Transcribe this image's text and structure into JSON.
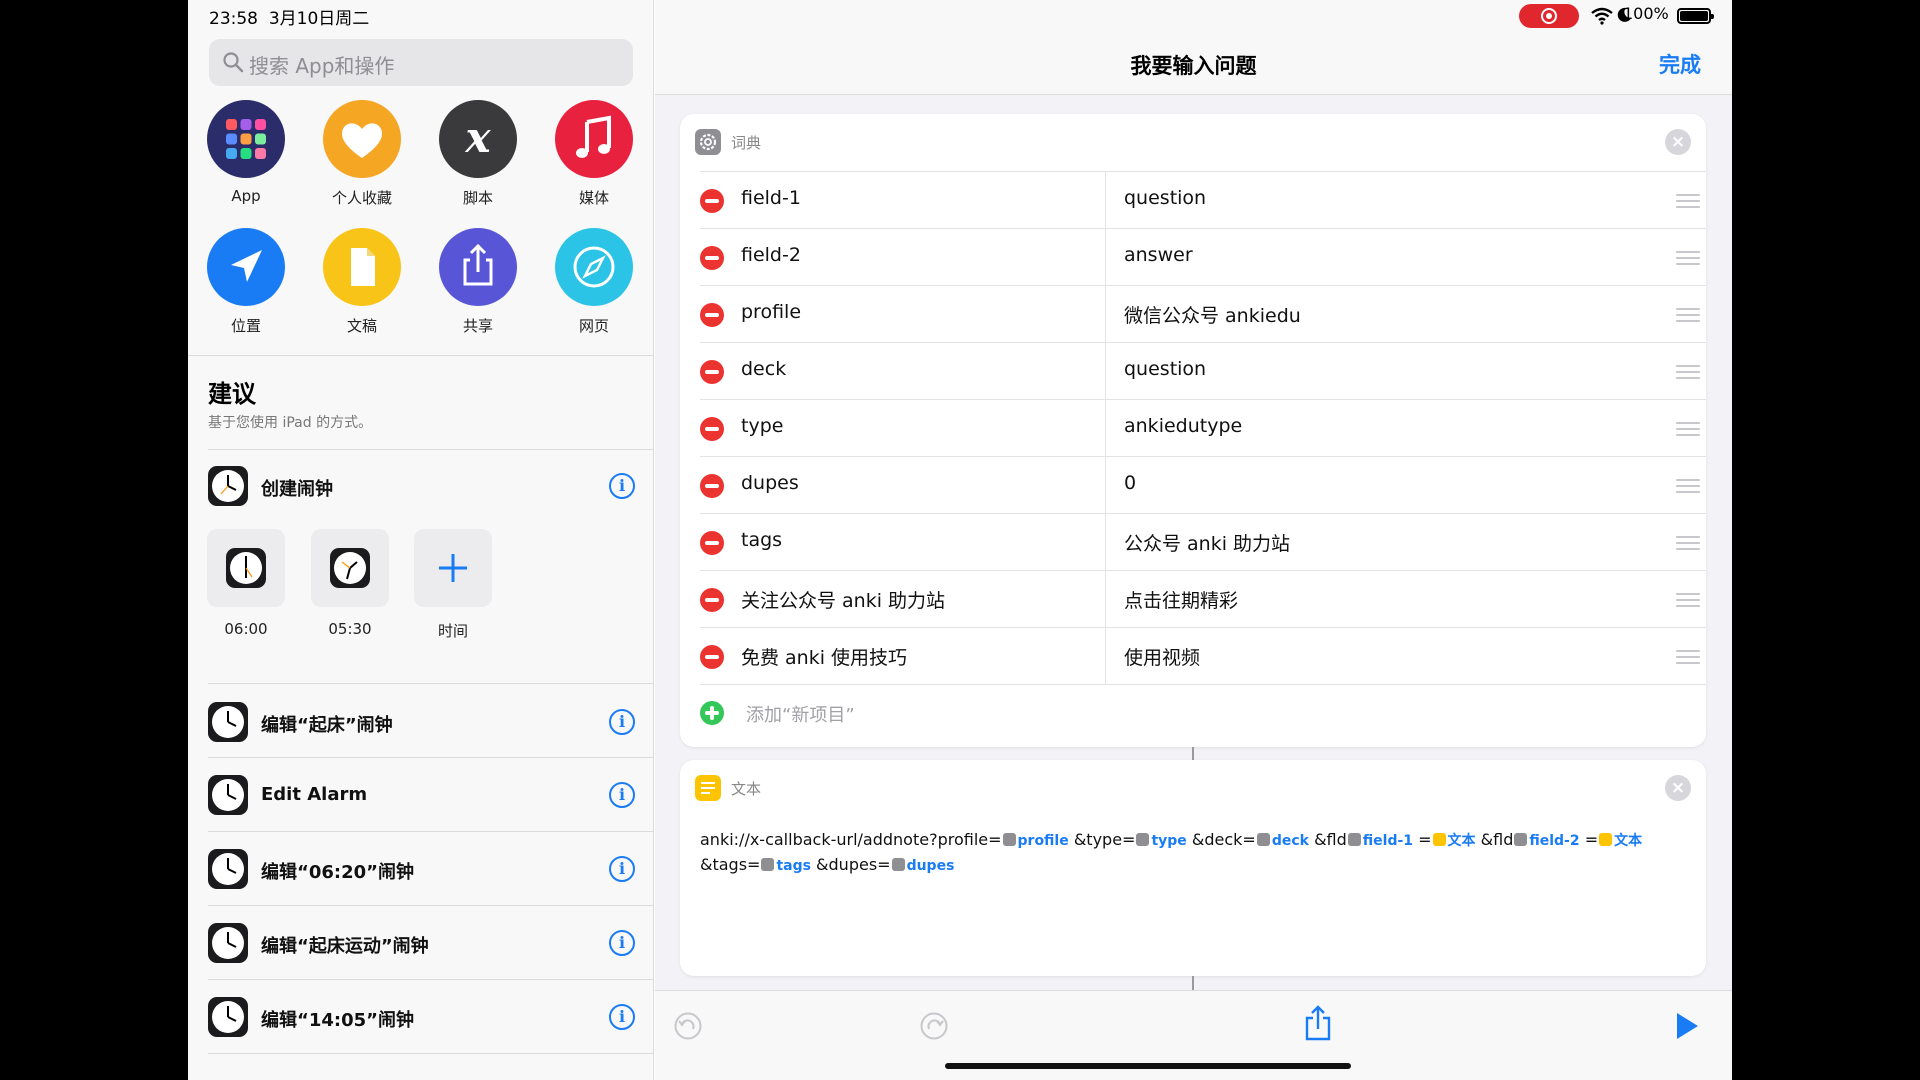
{
  "status": {
    "time": "23:58",
    "date": "3月10日周二",
    "battery": "100%"
  },
  "sidebar": {
    "search_placeholder": "搜索 App和操作",
    "categories": [
      {
        "label": "App",
        "icon": "app-grid-icon",
        "color": "#2b2d6b"
      },
      {
        "label": "个人收藏",
        "icon": "heart-icon",
        "color": "#f5a623"
      },
      {
        "label": "脚本",
        "icon": "script-x-icon",
        "color": "#3a3a3c"
      },
      {
        "label": "媒体",
        "icon": "music-note-icon",
        "color": "#e8213f"
      },
      {
        "label": "位置",
        "icon": "location-arrow-icon",
        "color": "#1a7cf5"
      },
      {
        "label": "文稿",
        "icon": "document-icon",
        "color": "#f8c418"
      },
      {
        "label": "共享",
        "icon": "share-icon",
        "color": "#5856d6"
      },
      {
        "label": "网页",
        "icon": "compass-icon",
        "color": "#2bc3e6"
      }
    ],
    "suggestions_title": "建议",
    "suggestions_subtitle": "基于您使用 iPad 的方式。",
    "create_alarm": "创建闹钟",
    "alarm_tiles": [
      "06:00",
      "05:30",
      "时间"
    ],
    "rows": [
      "编辑“起床”闹钟",
      "Edit Alarm",
      "编辑“06:20”闹钟",
      "编辑“起床运动”闹钟",
      "编辑“14:05”闹钟"
    ]
  },
  "main": {
    "title": "我要输入问题",
    "done": "完成",
    "dictionary": {
      "title": "词典",
      "rows": [
        {
          "key": "field-1",
          "value": "question"
        },
        {
          "key": "field-2",
          "value": "answer"
        },
        {
          "key": "profile",
          "value": "微信公众号 ankiedu"
        },
        {
          "key": "deck",
          "value": "question"
        },
        {
          "key": "type",
          "value": "ankiedutype"
        },
        {
          "key": "dupes",
          "value": "0"
        },
        {
          "key": "tags",
          "value": "公众号 anki 助力站"
        },
        {
          "key": "关注公众号 anki 助力站",
          "value": "点击往期精彩"
        },
        {
          "key": "免费 anki 使用技巧",
          "value": "使用视频"
        }
      ],
      "add_item": "添加“新项目”"
    },
    "text_action": {
      "title": "文本",
      "seg": {
        "p1": "anki://x-callback-url/addnote?profile=",
        "t_profile": "profile",
        "p2": "&type=",
        "t_type": "type",
        "p3": "&deck=",
        "t_deck": "deck",
        "p4": "&fld",
        "t_field1": "field-1",
        "p5": "=",
        "t_text1": "文本",
        "p6": "&fld",
        "t_field2": "field-2",
        "p7": "=",
        "t_text2": "文本",
        "p8": "&tags=",
        "t_tags": "tags",
        "p9": "&dupes=",
        "t_dupes": "dupes"
      }
    }
  },
  "colors": {
    "accent": "#1a7cf5",
    "delete": "#eb3330",
    "add": "#34c759",
    "recording": "#e0272d"
  }
}
